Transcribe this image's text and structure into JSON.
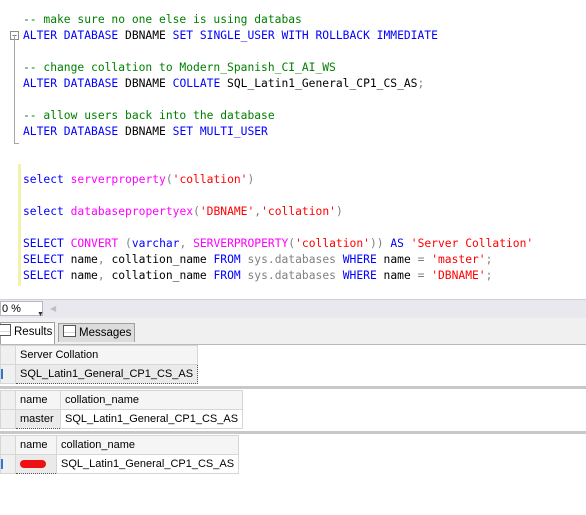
{
  "editor": {
    "lines": [
      {
        "tokens": [
          {
            "t": "cm",
            "v": "-- make sure no one else is using databas"
          }
        ]
      },
      {
        "tokens": [
          {
            "t": "kw",
            "v": "ALTER DATABASE"
          },
          {
            "t": "id",
            "v": " DBNAME "
          },
          {
            "t": "kw",
            "v": "SET SINGLE_USER WITH ROLLBACK IMMEDIATE"
          }
        ]
      },
      {
        "tokens": []
      },
      {
        "tokens": [
          {
            "t": "cm",
            "v": "-- change collation to Modern_Spanish_CI_AI_WS"
          }
        ]
      },
      {
        "tokens": [
          {
            "t": "kw",
            "v": "ALTER DATABASE"
          },
          {
            "t": "id",
            "v": " DBNAME "
          },
          {
            "t": "kw",
            "v": "COLLATE"
          },
          {
            "t": "id",
            "v": " SQL_Latin1_General_CP1_CS_AS"
          },
          {
            "t": "op",
            "v": ";"
          }
        ]
      },
      {
        "tokens": []
      },
      {
        "tokens": [
          {
            "t": "cm",
            "v": "-- allow users back into the database"
          }
        ]
      },
      {
        "tokens": [
          {
            "t": "kw",
            "v": "ALTER DATABASE"
          },
          {
            "t": "id",
            "v": " DBNAME "
          },
          {
            "t": "kw",
            "v": "SET MULTI_USER"
          }
        ]
      },
      {
        "tokens": []
      },
      {
        "tokens": []
      },
      {
        "tokens": [
          {
            "t": "kw",
            "v": "select"
          },
          {
            "t": "id",
            "v": " "
          },
          {
            "t": "fn",
            "v": "serverproperty"
          },
          {
            "t": "op",
            "v": "("
          },
          {
            "t": "str",
            "v": "'collation'"
          },
          {
            "t": "op",
            "v": ")"
          }
        ]
      },
      {
        "tokens": []
      },
      {
        "tokens": [
          {
            "t": "kw",
            "v": "select"
          },
          {
            "t": "id",
            "v": " "
          },
          {
            "t": "fn",
            "v": "databasepropertyex"
          },
          {
            "t": "op",
            "v": "("
          },
          {
            "t": "str",
            "v": "'DBNAME'"
          },
          {
            "t": "op",
            "v": ","
          },
          {
            "t": "str",
            "v": "'collation'"
          },
          {
            "t": "op",
            "v": ")"
          }
        ]
      },
      {
        "tokens": []
      },
      {
        "tokens": [
          {
            "t": "kw",
            "v": "SELECT"
          },
          {
            "t": "id",
            "v": " "
          },
          {
            "t": "fn",
            "v": "CONVERT"
          },
          {
            "t": "id",
            "v": " "
          },
          {
            "t": "op",
            "v": "("
          },
          {
            "t": "kw",
            "v": "varchar"
          },
          {
            "t": "op",
            "v": ", "
          },
          {
            "t": "fn",
            "v": "SERVERPROPERTY"
          },
          {
            "t": "op",
            "v": "("
          },
          {
            "t": "str",
            "v": "'collation'"
          },
          {
            "t": "op",
            "v": "))"
          },
          {
            "t": "id",
            "v": " "
          },
          {
            "t": "kw",
            "v": "AS"
          },
          {
            "t": "id",
            "v": " "
          },
          {
            "t": "str",
            "v": "'Server Collation'"
          }
        ]
      },
      {
        "tokens": [
          {
            "t": "kw",
            "v": "SELECT"
          },
          {
            "t": "id",
            "v": " name"
          },
          {
            "t": "op",
            "v": ","
          },
          {
            "t": "id",
            "v": " collation_name "
          },
          {
            "t": "kw",
            "v": "FROM"
          },
          {
            "t": "id",
            "v": " "
          },
          {
            "t": "op",
            "v": "sys.databases"
          },
          {
            "t": "id",
            "v": " "
          },
          {
            "t": "kw",
            "v": "WHERE"
          },
          {
            "t": "id",
            "v": " name "
          },
          {
            "t": "op",
            "v": "="
          },
          {
            "t": "id",
            "v": " "
          },
          {
            "t": "str",
            "v": "'master'"
          },
          {
            "t": "op",
            "v": ";"
          }
        ]
      },
      {
        "tokens": [
          {
            "t": "kw",
            "v": "SELECT"
          },
          {
            "t": "id",
            "v": " name"
          },
          {
            "t": "op",
            "v": ","
          },
          {
            "t": "id",
            "v": " collation_name "
          },
          {
            "t": "kw",
            "v": "FROM"
          },
          {
            "t": "id",
            "v": " "
          },
          {
            "t": "op",
            "v": "sys.databases"
          },
          {
            "t": "id",
            "v": " "
          },
          {
            "t": "kw",
            "v": "WHERE"
          },
          {
            "t": "id",
            "v": " name "
          },
          {
            "t": "op",
            "v": "="
          },
          {
            "t": "id",
            "v": " "
          },
          {
            "t": "str",
            "v": "'DBNAME'"
          },
          {
            "t": "op",
            "v": ";"
          }
        ]
      }
    ],
    "collapse_glyph": "−"
  },
  "status": {
    "zoom": "0 %",
    "zoom_arrow": "▼",
    "scroll_left": "◀"
  },
  "tabs": {
    "results": "Results",
    "messages": "Messages"
  },
  "grids": {
    "grid1": {
      "columns": [
        "Server Collation"
      ],
      "rows": [
        [
          "SQL_Latin1_General_CP1_CS_AS"
        ]
      ]
    },
    "grid2": {
      "columns": [
        "name",
        "collation_name"
      ],
      "rows": [
        [
          "master",
          "SQL_Latin1_General_CP1_CS_AS"
        ]
      ]
    },
    "grid3": {
      "columns": [
        "name",
        "collation_name"
      ],
      "rows": [
        [
          "",
          "SQL_Latin1_General_CP1_CS_AS"
        ]
      ]
    }
  },
  "colors": {
    "keyword": "#0000ff",
    "function": "#ff00ff",
    "string": "#ff0000",
    "comment": "#008000",
    "operator": "#808080"
  }
}
